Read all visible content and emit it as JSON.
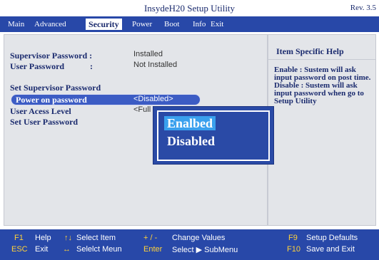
{
  "window": {
    "title": "InsydeH20 Setup Utility",
    "revision": "Rev. 3.5"
  },
  "menu": {
    "items": [
      "Main",
      "Advanced",
      "Security",
      "Power",
      "Boot",
      "Info",
      "Exit"
    ],
    "active": "Security"
  },
  "settings": {
    "supervisor_password": {
      "label": "Supervisor Password :",
      "value": "Installed"
    },
    "user_password": {
      "label": "User Password",
      "separator": ":",
      "value": "Not Installed"
    },
    "set_supervisor_password": {
      "label": "Set Supervisor Password"
    },
    "power_on_password": {
      "label": "Power on password",
      "value": "<Disabled>"
    },
    "user_access_level": {
      "label": "User Acess Level",
      "value": "<Full"
    },
    "set_user_password": {
      "label": "Set User Password"
    }
  },
  "help": {
    "title": "Item Specific Help",
    "text": "Enable : Sustem will ask input password on post time. Disable : Sustem will ask input password when go to Setup Utility"
  },
  "popup": {
    "options": [
      "Enalbed",
      "Disabled"
    ],
    "selected": "Enalbed"
  },
  "footer": {
    "row1": [
      {
        "key": "F1",
        "desc": "Help"
      },
      {
        "key": "↑↓",
        "desc": "Select Item"
      },
      {
        "key": "+ / -",
        "desc": "Change Values"
      },
      {
        "key": "F9",
        "desc": "Setup Defaults"
      }
    ],
    "row2": [
      {
        "key": "ESC",
        "desc": "Exit"
      },
      {
        "key": "↔",
        "desc": "Selelct Meun"
      },
      {
        "key": "Enter",
        "desc": "Select ▶ SubMenu"
      },
      {
        "key": "F10",
        "desc": "Save and Exit"
      }
    ]
  },
  "colors": {
    "menu_bar": "#2848a8",
    "panel": "#e3e5e9",
    "text_navy": "#1b2b6e",
    "highlight": "#3c5cc4",
    "popup_selected": "#3aa0ee",
    "footer_key": "#ffd23a"
  }
}
